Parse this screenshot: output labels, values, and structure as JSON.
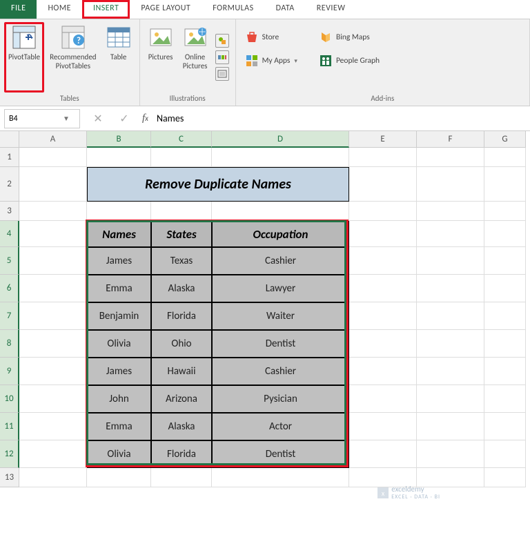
{
  "tabs": [
    "FILE",
    "HOME",
    "INSERT",
    "PAGE LAYOUT",
    "FORMULAS",
    "DATA",
    "REVIEW"
  ],
  "ribbon": {
    "pivot": "PivotTable",
    "recommended": "Recommended\nPivotTables",
    "table": "Table",
    "pictures": "Pictures",
    "online": "Online\nPictures",
    "store": "Store",
    "myapps": "My Apps",
    "bingmaps": "Bing Maps",
    "peoplegraph": "People Graph",
    "grp_tables": "Tables",
    "grp_illus": "Illustrations",
    "grp_addins": "Add-ins"
  },
  "nameBox": "B4",
  "formula": "Names",
  "columns": [
    {
      "l": "A",
      "w": 98
    },
    {
      "l": "B",
      "w": 93
    },
    {
      "l": "C",
      "w": 88
    },
    {
      "l": "D",
      "w": 199
    },
    {
      "l": "E",
      "w": 98
    },
    {
      "l": "F",
      "w": 98
    },
    {
      "l": "G",
      "w": 60
    }
  ],
  "rowHeights": {
    "default": 28,
    "r2": 50,
    "r4": 38,
    "data": 40
  },
  "title": "Remove Duplicate Names",
  "headers": [
    "Names",
    "States",
    "Occupation"
  ],
  "rows": [
    [
      "James",
      "Texas",
      "Cashier"
    ],
    [
      "Emma",
      "Alaska",
      "Lawyer"
    ],
    [
      "Benjamin",
      "Florida",
      "Waiter"
    ],
    [
      "Olivia",
      "Ohio",
      "Dentist"
    ],
    [
      "James",
      "Hawaii",
      "Cashier"
    ],
    [
      "John",
      "Arizona",
      "Pysician"
    ],
    [
      "Emma",
      "Alaska",
      "Actor"
    ],
    [
      "Olivia",
      "Florida",
      "Dentist"
    ]
  ],
  "watermark": {
    "brand": "exceldemy",
    "sub": "EXCEL · DATA · BI"
  }
}
